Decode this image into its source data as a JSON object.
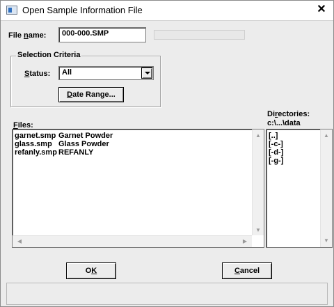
{
  "window": {
    "title": "Open Sample Information File",
    "close_glyph": "✕"
  },
  "file_name": {
    "label_pre": "File ",
    "label_mnemonic": "n",
    "label_post": "ame:",
    "value": "000-000.SMP"
  },
  "selection_criteria": {
    "title": "Selection Criteria",
    "status_label_mnemonic": "S",
    "status_label_post": "tatus:",
    "status_value": "All",
    "date_range_mnemonic": "D",
    "date_range_post": "ate Range..."
  },
  "files": {
    "label_mnemonic": "F",
    "label_post": "iles:",
    "items": [
      {
        "name": "garnet.smp",
        "description": "Garnet Powder"
      },
      {
        "name": "glass.smp",
        "description": "Glass Powder"
      },
      {
        "name": "refanly.smp",
        "description": "REFANLY"
      }
    ]
  },
  "directories": {
    "label_pre": "Di",
    "label_mnemonic": "r",
    "label_post": "ectories:",
    "current_path": "c:\\...\\data",
    "items": [
      "[..]",
      "[-c-]",
      "[-d-]",
      "[-g-]"
    ]
  },
  "buttons": {
    "ok_pre": "O",
    "ok_mnemonic": "K",
    "cancel_mnemonic": "C",
    "cancel_post": "ancel"
  },
  "scroll_arrows": {
    "up": "▲",
    "down": "▼",
    "left": "◀",
    "right": "▶"
  }
}
